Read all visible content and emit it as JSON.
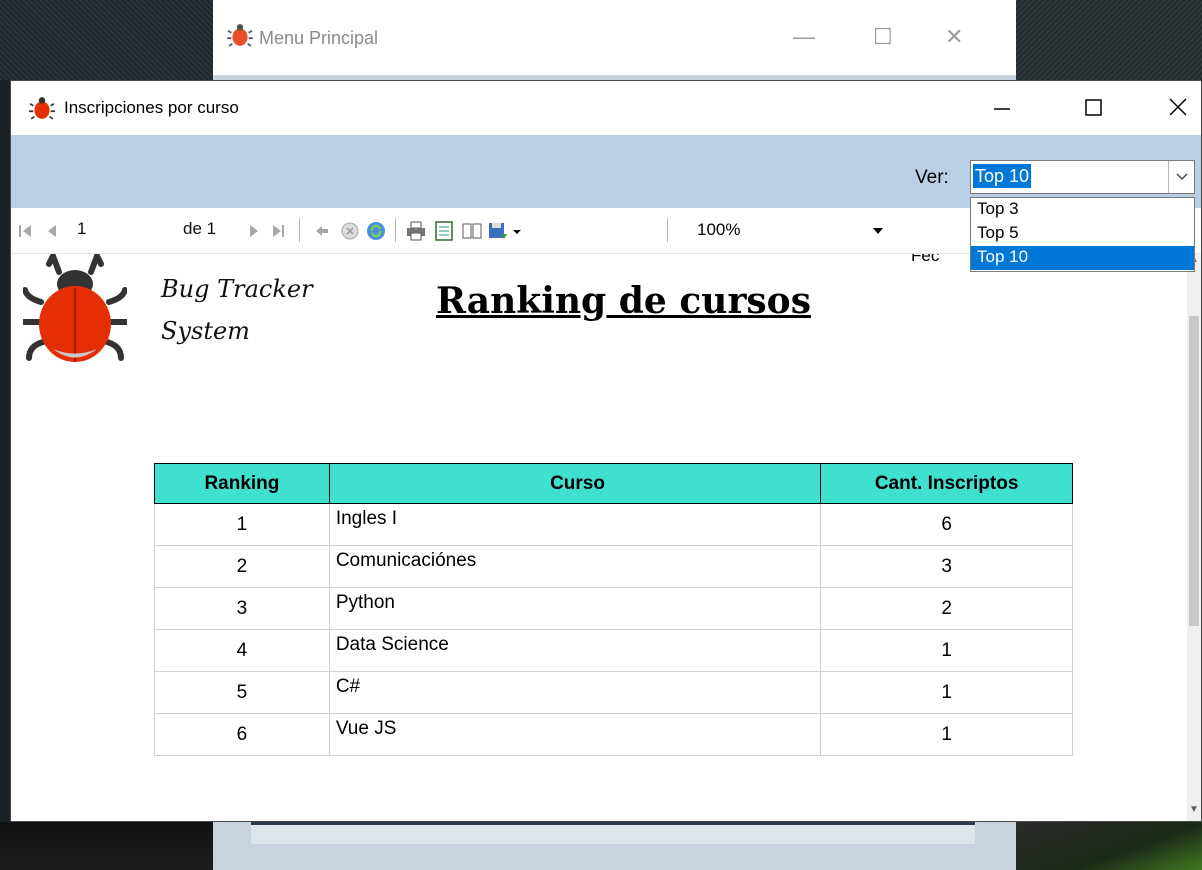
{
  "background_window": {
    "title": "Menu Principal"
  },
  "window": {
    "title": "Inscripciones por curso"
  },
  "filter": {
    "label": "Ver:",
    "selected": "Top 10",
    "options": [
      "Top 3",
      "Top 5",
      "Top 10"
    ]
  },
  "toolbar": {
    "page": "1",
    "of_label": "de 1",
    "zoom": "100%"
  },
  "report": {
    "brand_line1": "Bug Tracker",
    "brand_line2": "System",
    "title": "Ranking de cursos",
    "date_label_partial": "Fec",
    "columns": [
      "Ranking",
      "Curso",
      "Cant. Inscriptos"
    ],
    "rows": [
      {
        "rank": "1",
        "curso": "Ingles I",
        "cant": "6"
      },
      {
        "rank": "2",
        "curso": "Comunicaciónes",
        "cant": "3"
      },
      {
        "rank": "3",
        "curso": "Python",
        "cant": "2"
      },
      {
        "rank": "4",
        "curso": "Data Science",
        "cant": "1"
      },
      {
        "rank": "5",
        "curso": "C#",
        "cant": "1"
      },
      {
        "rank": "6",
        "curso": "Vue JS",
        "cant": "1"
      }
    ]
  },
  "colors": {
    "header_bg": "#40e0d0",
    "filter_bar_bg": "#b8cfe6",
    "selection": "#0078d7",
    "bug_red": "#e62e04"
  },
  "icons": [
    "bug-icon",
    "first-page-icon",
    "prev-page-icon",
    "next-page-icon",
    "last-page-icon",
    "back-icon",
    "stop-icon",
    "refresh-icon",
    "print-icon",
    "print-layout-icon",
    "page-setup-icon",
    "export-icon",
    "chevron-down-icon"
  ]
}
